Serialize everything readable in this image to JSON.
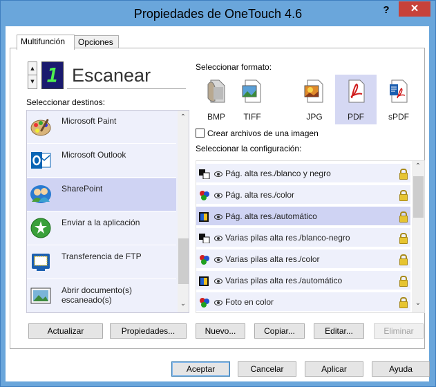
{
  "window": {
    "title": "Propiedades de OneTouch 4.6",
    "help_label": "?",
    "close_label": "✕"
  },
  "tabs": [
    {
      "label": "Multifunción",
      "active": true
    },
    {
      "label": "Opciones",
      "active": false
    }
  ],
  "action": {
    "number": "1",
    "name": "Escanear"
  },
  "destinations": {
    "label": "Seleccionar destinos:",
    "items": [
      {
        "label": "Microsoft Paint",
        "icon": "paint-palette-icon",
        "selected": false
      },
      {
        "label": "Microsoft Outlook",
        "icon": "outlook-icon",
        "selected": false
      },
      {
        "label": "SharePoint",
        "icon": "sharepoint-icon",
        "selected": true
      },
      {
        "label": "Enviar a la aplicación",
        "icon": "send-to-app-icon",
        "selected": false
      },
      {
        "label": "Transferencia de FTP",
        "icon": "ftp-icon",
        "selected": false
      },
      {
        "label": "Abrir documento(s) escaneado(s)",
        "icon": "open-document-icon",
        "selected": false
      }
    ]
  },
  "format": {
    "label": "Seleccionar formato:",
    "items": [
      {
        "label": "BMP",
        "icon": "bmp-icon",
        "selected": false
      },
      {
        "label": "TIFF",
        "icon": "tiff-icon",
        "selected": false
      },
      {
        "label": "JPG",
        "icon": "jpg-icon",
        "selected": false
      },
      {
        "label": "PDF",
        "icon": "pdf-icon",
        "selected": true
      },
      {
        "label": "sPDF",
        "icon": "spdf-icon",
        "selected": false
      }
    ],
    "single_image_label": "Crear archivos de una imagen",
    "single_image_checked": false
  },
  "configuration": {
    "label": "Seleccionar la configuración:",
    "items": [
      {
        "label": "Pág. alta res./blanco y negro",
        "icon": "bw-icon",
        "selected": false
      },
      {
        "label": "Pág. alta res./color",
        "icon": "color-icon",
        "selected": false
      },
      {
        "label": "Pág. alta res./automático",
        "icon": "auto-icon",
        "selected": true
      },
      {
        "label": "Varias pilas alta res./blanco-negro",
        "icon": "bw-icon",
        "selected": false
      },
      {
        "label": "Varias pilas alta res./color",
        "icon": "color-icon",
        "selected": false
      },
      {
        "label": "Varias pilas alta res./automático",
        "icon": "auto-icon",
        "selected": false
      },
      {
        "label": "Foto en color",
        "icon": "color-icon",
        "selected": false
      }
    ]
  },
  "buttons": {
    "refresh": "Actualizar",
    "properties": "Propiedades...",
    "new": "Nuevo...",
    "copy": "Copiar...",
    "edit": "Editar...",
    "delete": "Eliminar"
  },
  "footer": {
    "ok": "Aceptar",
    "cancel": "Cancelar",
    "apply": "Aplicar",
    "help": "Ayuda"
  },
  "colors": {
    "title_bar": "#6aa6db",
    "close_button": "#c7423a",
    "list_background": "#eef0fb",
    "selection": "#cfd3f3",
    "lcd_background": "#1a1a6e",
    "lcd_digit": "#4ef04e"
  }
}
